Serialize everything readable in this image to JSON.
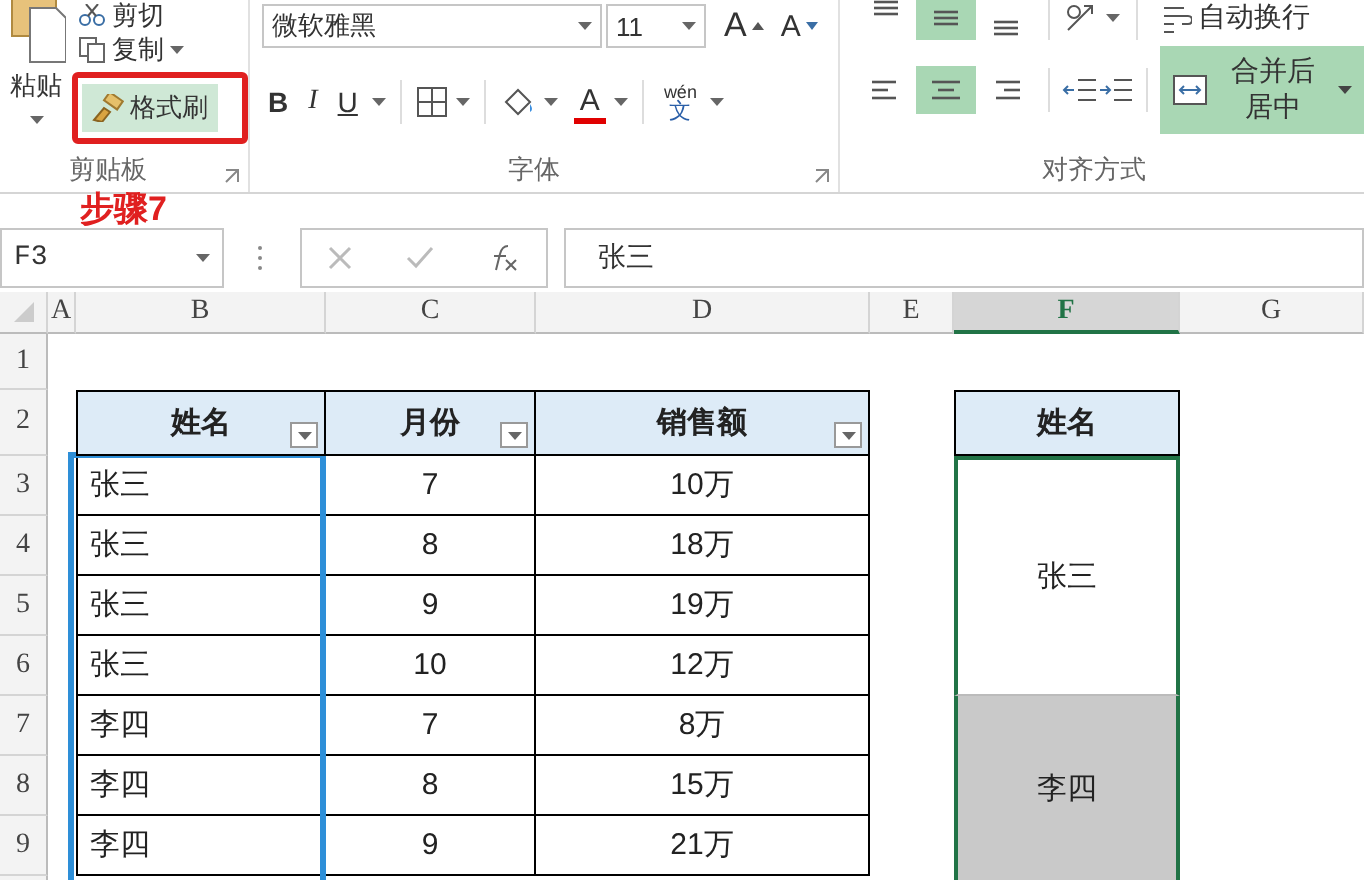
{
  "ribbon": {
    "clipboard": {
      "paste": "粘贴",
      "cut": "剪切",
      "copy": "复制",
      "format_painter": {
        "label": "格式刷",
        "selected": true
      },
      "group_label": "剪贴板"
    },
    "font": {
      "name": "微软雅黑",
      "size": "11",
      "grow_font": "A",
      "shrink_font": "A",
      "bold": "B",
      "italic": "I",
      "underline": "U",
      "font_color": "A",
      "phonetic_pinyin": "wén",
      "phonetic_char": "文",
      "group_label": "字体"
    },
    "alignment": {
      "vertical_buttons": [
        {
          "kind": "top",
          "selected": false
        },
        {
          "kind": "middle",
          "selected": true
        },
        {
          "kind": "bottom",
          "selected": false
        }
      ],
      "horizontal_buttons": [
        {
          "kind": "left",
          "selected": false
        },
        {
          "kind": "center",
          "selected": true
        },
        {
          "kind": "right",
          "selected": false
        }
      ],
      "wrap_text": {
        "label": "自动换行",
        "selected": false
      },
      "merge_center": {
        "label": "合并后居中",
        "selected": true
      },
      "group_label": "对齐方式"
    }
  },
  "annotation": "步骤7",
  "formula_bar": {
    "name_box": "F3",
    "formula": "张三"
  },
  "sheet": {
    "columns": [
      {
        "label": "A",
        "selected": false
      },
      {
        "label": "B",
        "selected": false
      },
      {
        "label": "C",
        "selected": false
      },
      {
        "label": "D",
        "selected": false
      },
      {
        "label": "E",
        "selected": false
      },
      {
        "label": "F",
        "selected": true
      },
      {
        "label": "G",
        "selected": false
      }
    ],
    "row_labels": [
      "1",
      "2",
      "3",
      "4",
      "5",
      "6",
      "7",
      "8",
      "9"
    ],
    "table": {
      "columns": [
        "姓名",
        "月份",
        "销售额"
      ],
      "rows": [
        [
          "张三",
          "7",
          "10万"
        ],
        [
          "张三",
          "8",
          "18万"
        ],
        [
          "张三",
          "9",
          "19万"
        ],
        [
          "张三",
          "10",
          "12万"
        ],
        [
          "李四",
          "7",
          "8万"
        ],
        [
          "李四",
          "8",
          "15万"
        ],
        [
          "李四",
          "9",
          "21万"
        ]
      ]
    },
    "merged_column": {
      "header": "姓名",
      "groups": [
        {
          "value": "张三",
          "shaded": false
        },
        {
          "value": "李四",
          "shaded": true
        }
      ]
    }
  }
}
